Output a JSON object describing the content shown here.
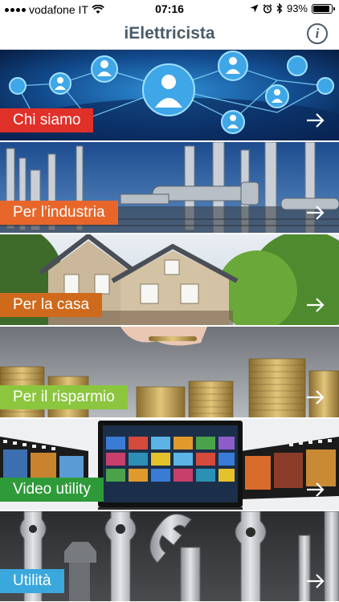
{
  "status": {
    "carrier": "vodafone IT",
    "time": "07:16",
    "battery_text": "93%",
    "battery_level": 0.93
  },
  "nav": {
    "title": "iElettricista",
    "info_icon": "info-icon"
  },
  "menu": {
    "items": [
      {
        "label": "Chi siamo",
        "color": "#e0302a",
        "image": "network-people"
      },
      {
        "label": "Per l'industria",
        "color": "#e8662a",
        "image": "industrial-plant"
      },
      {
        "label": "Per la casa",
        "color": "#cf6a1d",
        "image": "house"
      },
      {
        "label": "Per il risparmio",
        "color": "#8cc63f",
        "image": "coin-stacks"
      },
      {
        "label": "Video utility",
        "color": "#2f9a3a",
        "image": "tv-film-strip"
      },
      {
        "label": "Utilità",
        "color": "#3aa8dc",
        "image": "wrenches"
      }
    ]
  }
}
